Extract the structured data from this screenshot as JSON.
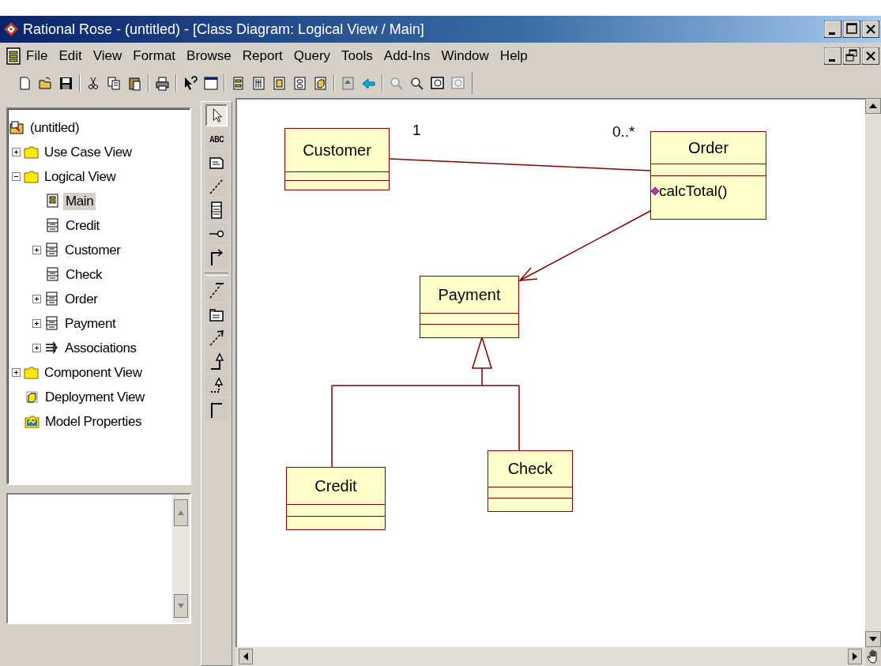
{
  "window": {
    "title": "Rational Rose - (untitled) - [Class Diagram: Logical View / Main]"
  },
  "menu": [
    "File",
    "Edit",
    "View",
    "Format",
    "Browse",
    "Report",
    "Query",
    "Tools",
    "Add-Ins",
    "Window",
    "Help"
  ],
  "browser": {
    "tree": [
      {
        "label": "(untitled)",
        "kind": "model",
        "selected": false,
        "children": [
          {
            "label": "Use Case View",
            "kind": "folder",
            "selected": false,
            "expanded": false
          },
          {
            "label": "Logical View",
            "kind": "folder",
            "selected": false,
            "expanded": true,
            "children": [
              {
                "label": "Main",
                "kind": "diagram",
                "selected": true
              },
              {
                "label": "Credit",
                "kind": "class",
                "selected": false
              },
              {
                "label": "Customer",
                "kind": "class",
                "selected": false,
                "expanded": false
              },
              {
                "label": "Check",
                "kind": "class",
                "selected": false
              },
              {
                "label": "Order",
                "kind": "class",
                "selected": false,
                "expanded": false
              },
              {
                "label": "Payment",
                "kind": "class",
                "selected": false,
                "expanded": false
              },
              {
                "label": "Associations",
                "kind": "associations",
                "selected": false,
                "expanded": false
              }
            ]
          },
          {
            "label": "Component View",
            "kind": "folder",
            "selected": false,
            "expanded": false
          },
          {
            "label": "Deployment View",
            "kind": "deployment",
            "selected": false
          },
          {
            "label": "Model Properties",
            "kind": "properties",
            "selected": false
          }
        ]
      }
    ]
  },
  "toolbox": [
    {
      "kind": "pointer",
      "selected": true
    },
    {
      "kind": "text",
      "label": "ABC",
      "selected": false
    },
    {
      "kind": "note",
      "selected": false
    },
    {
      "kind": "note-link",
      "selected": false
    },
    {
      "kind": "class",
      "selected": false
    },
    {
      "kind": "interface",
      "selected": false
    },
    {
      "kind": "association",
      "selected": false
    },
    {
      "kind": "separator"
    },
    {
      "kind": "dependency-line",
      "selected": false
    },
    {
      "kind": "package",
      "selected": false
    },
    {
      "kind": "dependency",
      "selected": false
    },
    {
      "kind": "generalization",
      "selected": false
    },
    {
      "kind": "realization",
      "selected": false
    },
    {
      "kind": "corner",
      "selected": false
    }
  ],
  "diagram": {
    "classes": [
      {
        "name": "Customer"
      },
      {
        "name": "Order",
        "operations": [
          "calcTotal()"
        ]
      },
      {
        "name": "Payment"
      },
      {
        "name": "Credit"
      },
      {
        "name": "Check"
      }
    ],
    "relations": [
      {
        "kind": "association",
        "from_multiplicity": "1",
        "to_multiplicity": "0..*"
      },
      {
        "kind": "navigable"
      },
      {
        "kind": "generalization"
      }
    ]
  }
}
